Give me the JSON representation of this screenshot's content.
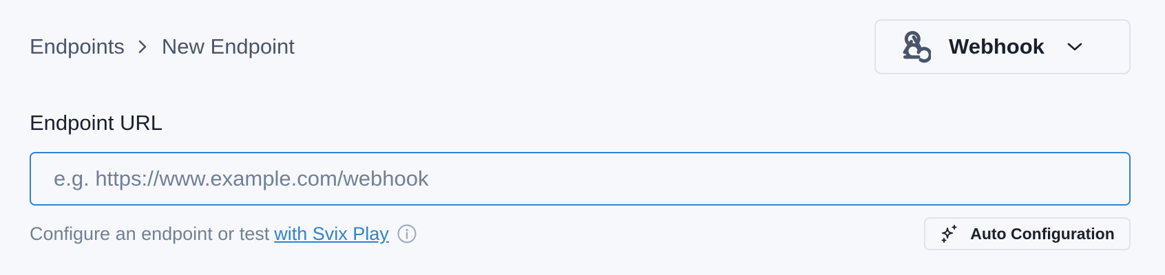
{
  "breadcrumb": {
    "parent": "Endpoints",
    "current": "New Endpoint",
    "separator_icon": "chevron-right-icon"
  },
  "endpoint_type": {
    "selected": "Webhook",
    "icon": "webhook-icon",
    "dropdown_icon": "chevron-down-icon"
  },
  "url_field": {
    "label": "Endpoint URL",
    "value": "",
    "placeholder": "e.g. https://www.example.com/webhook"
  },
  "help": {
    "text": "Configure an endpoint or test",
    "link_text": "with Svix Play",
    "info_icon": "info-icon"
  },
  "auto_config": {
    "label": "Auto Configuration",
    "icon": "sparkles-icon"
  },
  "colors": {
    "background": "#f7f8fb",
    "accent": "#3182ce",
    "border": "#dfe3ea",
    "muted_text": "#718096"
  }
}
